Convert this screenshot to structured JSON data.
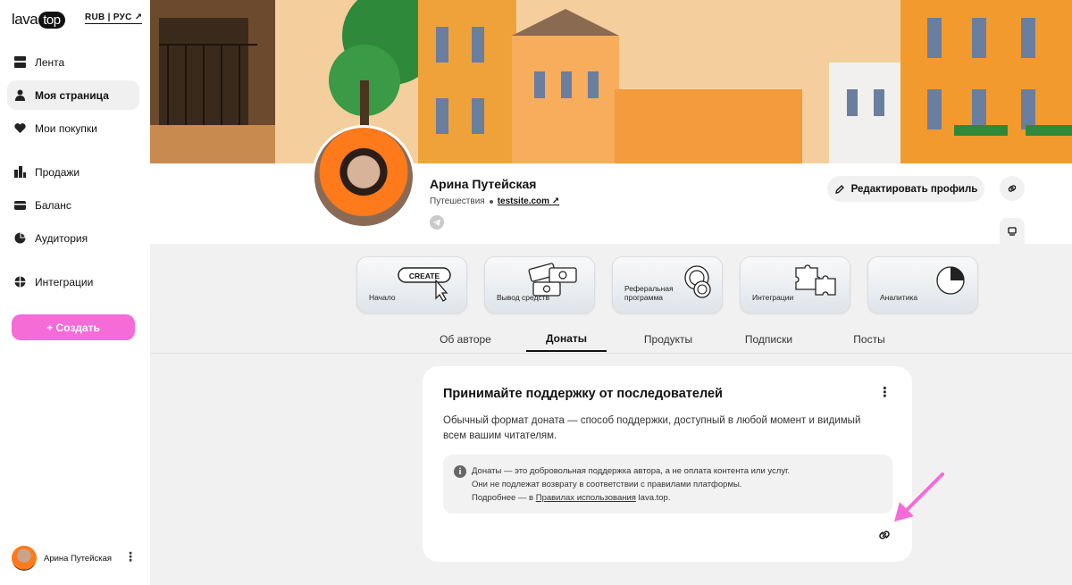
{
  "brand": {
    "logo_text": "lava",
    "logo_pill": "top",
    "accent": "#f56bd8"
  },
  "header": {
    "lang": "RUB | РУС ↗"
  },
  "sidebar": {
    "items": [
      {
        "label": "Лента",
        "icon": "feed-icon"
      },
      {
        "label": "Моя страница",
        "icon": "user-icon",
        "active": true
      },
      {
        "label": "Мои покупки",
        "icon": "heart-icon"
      },
      {
        "label": "Продажи",
        "icon": "bar-chart-icon"
      },
      {
        "label": "Баланс",
        "icon": "wallet-icon"
      },
      {
        "label": "Аудитория",
        "icon": "pie-chart-icon"
      },
      {
        "label": "Интеграции",
        "icon": "integrations-icon"
      }
    ],
    "create_label": "+  Создать",
    "user_name": "Арина Путейская"
  },
  "profile": {
    "name": "Арина Путейская",
    "category": "Путешествия",
    "site": "testsite.com ↗",
    "edit_label": "Редактировать профиль"
  },
  "quick_cards": [
    {
      "label": "Начало",
      "icon": "create-cursor-icon"
    },
    {
      "label": "Вывод средств",
      "icon": "money-icon"
    },
    {
      "label": "Реферальная\nпрограмма",
      "icon": "coins-icon"
    },
    {
      "label": "Интеграции",
      "icon": "puzzle-icon"
    },
    {
      "label": "Аналитика",
      "icon": "pie-icon"
    }
  ],
  "create_badge": "CREATE",
  "tabs": [
    {
      "label": "Об авторе"
    },
    {
      "label": "Донаты",
      "active": true
    },
    {
      "label": "Продукты"
    },
    {
      "label": "Подписки"
    },
    {
      "label": "Посты"
    }
  ],
  "card": {
    "title": "Принимайте поддержку от последователей",
    "description": "Обычный формат доната — способ поддержки, доступный в любой момент и видимый всем вашим читателям.",
    "notice_line1": "Донаты — это добровольная поддержка автора, а не оплата контента или услуг.",
    "notice_line2": "Они не подлежат возврату в соответствии с правилами платформы.",
    "notice_line3_prefix": "Подробнее — в ",
    "notice_link": "Правилах использования",
    "notice_line3_suffix": " lava.top."
  }
}
